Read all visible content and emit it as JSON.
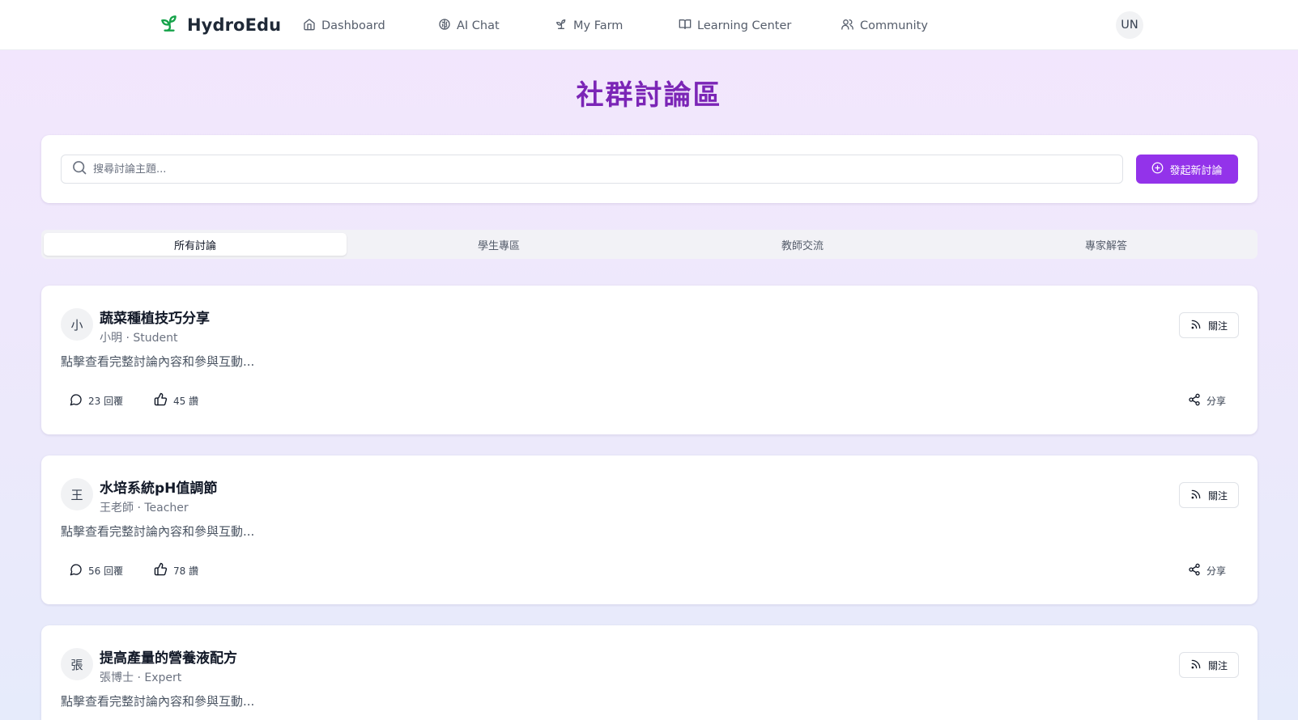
{
  "app": {
    "brand_name": "HydroEdu",
    "brand_icon": "sprout-icon",
    "accent_color": "#9333ea",
    "title_color": "#7b25b6",
    "brand_icon_color": "#16a34a"
  },
  "nav": {
    "items": [
      {
        "label": "Dashboard",
        "icon": "home-icon"
      },
      {
        "label": "AI Chat",
        "icon": "brain-icon"
      },
      {
        "label": "My Farm",
        "icon": "sprout-icon"
      },
      {
        "label": "Learning Center",
        "icon": "book-open-icon"
      },
      {
        "label": "Community",
        "icon": "users-icon"
      }
    ],
    "user_initials": "UN"
  },
  "page": {
    "title": "社群討論區"
  },
  "search": {
    "placeholder": "搜尋討論主題...",
    "value": "",
    "new_button_label": "發起新討論"
  },
  "tabs": [
    {
      "label": "所有討論",
      "active": true
    },
    {
      "label": "學生專區",
      "active": false
    },
    {
      "label": "教師交流",
      "active": false
    },
    {
      "label": "專家解答",
      "active": false
    }
  ],
  "posts": [
    {
      "avatar": "小",
      "title": "蔬菜種植技巧分享",
      "meta": "小明 · Student",
      "description": "點擊查看完整討論內容和參與互動...",
      "follow_label": "關注",
      "replies_label": "23 回覆",
      "likes_label": "45 讚",
      "share_label": "分享"
    },
    {
      "avatar": "王",
      "title": "水培系統pH值調節",
      "meta": "王老師 · Teacher",
      "description": "點擊查看完整討論內容和參與互動...",
      "follow_label": "關注",
      "replies_label": "56 回覆",
      "likes_label": "78 讚",
      "share_label": "分享"
    },
    {
      "avatar": "張",
      "title": "提高產量的營養液配方",
      "meta": "張博士 · Expert",
      "description": "點擊查看完整討論內容和參與互動...",
      "follow_label": "關注",
      "replies_label": "",
      "likes_label": "",
      "share_label": ""
    }
  ]
}
